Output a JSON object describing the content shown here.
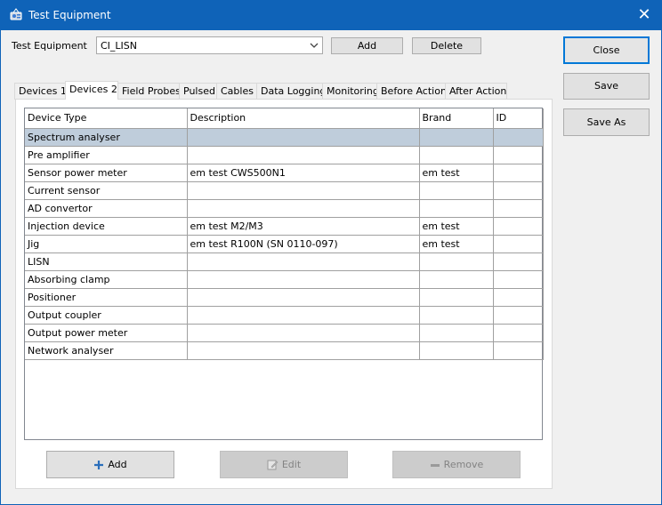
{
  "window": {
    "title": "Test Equipment",
    "close_glyph": "✕"
  },
  "equipment": {
    "label": "Test Equipment",
    "selected": "CI_LISN",
    "add_label": "Add",
    "delete_label": "Delete"
  },
  "side_buttons": {
    "close_label": "Close",
    "save_label": "Save",
    "save_as_label": "Save As"
  },
  "tabs": [
    {
      "label": "Devices 1"
    },
    {
      "label": "Devices 2"
    },
    {
      "label": "Field Probes"
    },
    {
      "label": "Pulsed"
    },
    {
      "label": "Cables"
    },
    {
      "label": "Data Logging"
    },
    {
      "label": "Monitoring"
    },
    {
      "label": "Before Action"
    },
    {
      "label": "After Action"
    }
  ],
  "active_tab": "Devices 2",
  "table": {
    "columns": [
      "Device Type",
      "Description",
      "Brand",
      "ID"
    ],
    "rows": [
      {
        "device_type": "Spectrum analyser",
        "description": "",
        "brand": "",
        "id": ""
      },
      {
        "device_type": "Pre amplifier",
        "description": "",
        "brand": "",
        "id": ""
      },
      {
        "device_type": "Sensor power meter",
        "description": "em test CWS500N1",
        "brand": "em test",
        "id": ""
      },
      {
        "device_type": "Current sensor",
        "description": "",
        "brand": "",
        "id": ""
      },
      {
        "device_type": "AD convertor",
        "description": "",
        "brand": "",
        "id": ""
      },
      {
        "device_type": "Injection device",
        "description": "em test M2/M3",
        "brand": "em test",
        "id": ""
      },
      {
        "device_type": "Jig",
        "description": "em test R100N (SN 0110-097)",
        "brand": "em test",
        "id": ""
      },
      {
        "device_type": "LISN",
        "description": "",
        "brand": "",
        "id": ""
      },
      {
        "device_type": "Absorbing clamp",
        "description": "",
        "brand": "",
        "id": ""
      },
      {
        "device_type": "Positioner",
        "description": "",
        "brand": "",
        "id": ""
      },
      {
        "device_type": "Output coupler",
        "description": "",
        "brand": "",
        "id": ""
      },
      {
        "device_type": "Output power meter",
        "description": "",
        "brand": "",
        "id": ""
      },
      {
        "device_type": "Network analyser",
        "description": "",
        "brand": "",
        "id": ""
      }
    ],
    "selected_row": 0
  },
  "row_buttons": {
    "add_label": "Add",
    "edit_label": "Edit",
    "remove_label": "Remove"
  },
  "icons": {
    "app": "equipment-app-icon",
    "add": "plus-icon",
    "edit": "edit-icon",
    "remove": "minus-icon",
    "dropdown": "chevron-down-icon"
  },
  "colors": {
    "titlebar": "#0f63b8",
    "selection": "#bfcddb",
    "focus_border": "#0078d7",
    "add_icon": "#2a6ebb"
  }
}
